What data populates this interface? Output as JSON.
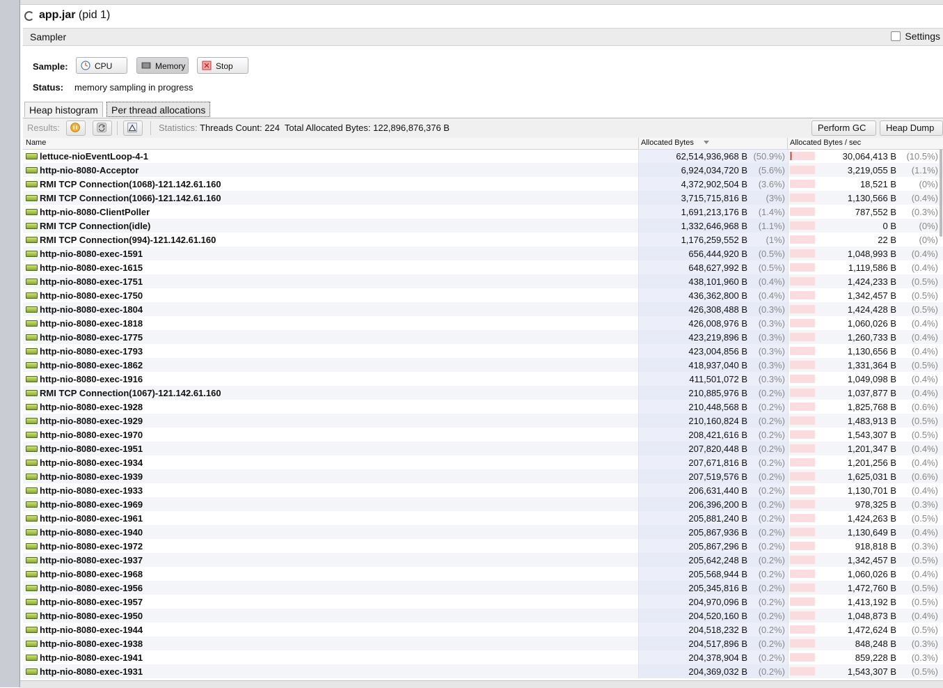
{
  "app": {
    "name": "app.jar",
    "pid": "(pid 1)"
  },
  "sampler": {
    "title": "Sampler",
    "settings_label": "Settings",
    "sample_label": "Sample:",
    "buttons": {
      "cpu": "CPU",
      "memory": "Memory",
      "stop": "Stop"
    },
    "status_label": "Status:",
    "status_value": "memory sampling in progress"
  },
  "tabs": [
    "Heap histogram",
    "Per thread allocations"
  ],
  "toolbar": {
    "results_label": "Results:",
    "statistics_label": "Statistics:",
    "threads_count": "Threads Count: 224",
    "total_allocated": "Total Allocated Bytes: 122,896,876,376 B",
    "perform_gc": "Perform GC",
    "heap_dump": "Heap Dump"
  },
  "columns": {
    "name": "Name",
    "allocated": "Allocated Bytes",
    "rate": "Allocated Bytes / sec"
  },
  "rows": [
    {
      "name": "lettuce-nioEventLoop-4-1",
      "bytes": "62,514,936,968 B",
      "pct": "(50.9%)",
      "rate": "30,064,413 B",
      "rate_pct": "(10.5%)",
      "rate_fraction": 0.105
    },
    {
      "name": "http-nio-8080-Acceptor",
      "bytes": "6,924,034,720 B",
      "pct": "(5.6%)",
      "rate": "3,219,055 B",
      "rate_pct": "(1.1%)",
      "rate_fraction": 0.011
    },
    {
      "name": "RMI TCP Connection(1068)-121.142.61.160",
      "bytes": "4,372,902,504 B",
      "pct": "(3.6%)",
      "rate": "18,521 B",
      "rate_pct": "(0%)",
      "rate_fraction": 0
    },
    {
      "name": "RMI TCP Connection(1066)-121.142.61.160",
      "bytes": "3,715,715,816 B",
      "pct": "(3%)",
      "rate": "1,130,566 B",
      "rate_pct": "(0.4%)",
      "rate_fraction": 0.004
    },
    {
      "name": "http-nio-8080-ClientPoller",
      "bytes": "1,691,213,176 B",
      "pct": "(1.4%)",
      "rate": "787,552 B",
      "rate_pct": "(0.3%)",
      "rate_fraction": 0.003
    },
    {
      "name": "RMI TCP Connection(idle)",
      "bytes": "1,332,646,968 B",
      "pct": "(1.1%)",
      "rate": "0 B",
      "rate_pct": "(0%)",
      "rate_fraction": 0
    },
    {
      "name": "RMI TCP Connection(994)-121.142.61.160",
      "bytes": "1,176,259,552 B",
      "pct": "(1%)",
      "rate": "22 B",
      "rate_pct": "(0%)",
      "rate_fraction": 0
    },
    {
      "name": "http-nio-8080-exec-1591",
      "bytes": "656,444,920 B",
      "pct": "(0.5%)",
      "rate": "1,048,993 B",
      "rate_pct": "(0.4%)",
      "rate_fraction": 0.004
    },
    {
      "name": "http-nio-8080-exec-1615",
      "bytes": "648,627,992 B",
      "pct": "(0.5%)",
      "rate": "1,119,586 B",
      "rate_pct": "(0.4%)",
      "rate_fraction": 0.004
    },
    {
      "name": "http-nio-8080-exec-1751",
      "bytes": "438,101,960 B",
      "pct": "(0.4%)",
      "rate": "1,424,233 B",
      "rate_pct": "(0.5%)",
      "rate_fraction": 0.005
    },
    {
      "name": "http-nio-8080-exec-1750",
      "bytes": "436,362,800 B",
      "pct": "(0.4%)",
      "rate": "1,342,457 B",
      "rate_pct": "(0.5%)",
      "rate_fraction": 0.005
    },
    {
      "name": "http-nio-8080-exec-1804",
      "bytes": "426,308,488 B",
      "pct": "(0.3%)",
      "rate": "1,424,428 B",
      "rate_pct": "(0.5%)",
      "rate_fraction": 0.005
    },
    {
      "name": "http-nio-8080-exec-1818",
      "bytes": "426,008,976 B",
      "pct": "(0.3%)",
      "rate": "1,060,026 B",
      "rate_pct": "(0.4%)",
      "rate_fraction": 0.004
    },
    {
      "name": "http-nio-8080-exec-1775",
      "bytes": "423,219,896 B",
      "pct": "(0.3%)",
      "rate": "1,260,733 B",
      "rate_pct": "(0.4%)",
      "rate_fraction": 0.004
    },
    {
      "name": "http-nio-8080-exec-1793",
      "bytes": "423,004,856 B",
      "pct": "(0.3%)",
      "rate": "1,130,656 B",
      "rate_pct": "(0.4%)",
      "rate_fraction": 0.004
    },
    {
      "name": "http-nio-8080-exec-1862",
      "bytes": "418,937,040 B",
      "pct": "(0.3%)",
      "rate": "1,331,364 B",
      "rate_pct": "(0.5%)",
      "rate_fraction": 0.005
    },
    {
      "name": "http-nio-8080-exec-1916",
      "bytes": "411,501,072 B",
      "pct": "(0.3%)",
      "rate": "1,049,098 B",
      "rate_pct": "(0.4%)",
      "rate_fraction": 0.004
    },
    {
      "name": "RMI TCP Connection(1067)-121.142.61.160",
      "bytes": "210,885,976 B",
      "pct": "(0.2%)",
      "rate": "1,037,877 B",
      "rate_pct": "(0.4%)",
      "rate_fraction": 0.004
    },
    {
      "name": "http-nio-8080-exec-1928",
      "bytes": "210,448,568 B",
      "pct": "(0.2%)",
      "rate": "1,825,768 B",
      "rate_pct": "(0.6%)",
      "rate_fraction": 0.006
    },
    {
      "name": "http-nio-8080-exec-1929",
      "bytes": "210,160,824 B",
      "pct": "(0.2%)",
      "rate": "1,483,913 B",
      "rate_pct": "(0.5%)",
      "rate_fraction": 0.005
    },
    {
      "name": "http-nio-8080-exec-1970",
      "bytes": "208,421,616 B",
      "pct": "(0.2%)",
      "rate": "1,543,307 B",
      "rate_pct": "(0.5%)",
      "rate_fraction": 0.005
    },
    {
      "name": "http-nio-8080-exec-1951",
      "bytes": "207,820,448 B",
      "pct": "(0.2%)",
      "rate": "1,201,347 B",
      "rate_pct": "(0.4%)",
      "rate_fraction": 0.004
    },
    {
      "name": "http-nio-8080-exec-1934",
      "bytes": "207,671,816 B",
      "pct": "(0.2%)",
      "rate": "1,201,256 B",
      "rate_pct": "(0.4%)",
      "rate_fraction": 0.004
    },
    {
      "name": "http-nio-8080-exec-1939",
      "bytes": "207,519,576 B",
      "pct": "(0.2%)",
      "rate": "1,625,031 B",
      "rate_pct": "(0.6%)",
      "rate_fraction": 0.006
    },
    {
      "name": "http-nio-8080-exec-1933",
      "bytes": "206,631,440 B",
      "pct": "(0.2%)",
      "rate": "1,130,701 B",
      "rate_pct": "(0.4%)",
      "rate_fraction": 0.004
    },
    {
      "name": "http-nio-8080-exec-1969",
      "bytes": "206,396,200 B",
      "pct": "(0.2%)",
      "rate": "978,325 B",
      "rate_pct": "(0.3%)",
      "rate_fraction": 0.003
    },
    {
      "name": "http-nio-8080-exec-1961",
      "bytes": "205,881,240 B",
      "pct": "(0.2%)",
      "rate": "1,424,263 B",
      "rate_pct": "(0.5%)",
      "rate_fraction": 0.005
    },
    {
      "name": "http-nio-8080-exec-1940",
      "bytes": "205,867,936 B",
      "pct": "(0.2%)",
      "rate": "1,130,649 B",
      "rate_pct": "(0.4%)",
      "rate_fraction": 0.004
    },
    {
      "name": "http-nio-8080-exec-1972",
      "bytes": "205,867,296 B",
      "pct": "(0.2%)",
      "rate": "918,818 B",
      "rate_pct": "(0.3%)",
      "rate_fraction": 0.003
    },
    {
      "name": "http-nio-8080-exec-1937",
      "bytes": "205,642,248 B",
      "pct": "(0.2%)",
      "rate": "1,342,457 B",
      "rate_pct": "(0.5%)",
      "rate_fraction": 0.005
    },
    {
      "name": "http-nio-8080-exec-1968",
      "bytes": "205,568,944 B",
      "pct": "(0.2%)",
      "rate": "1,060,026 B",
      "rate_pct": "(0.4%)",
      "rate_fraction": 0.004
    },
    {
      "name": "http-nio-8080-exec-1956",
      "bytes": "205,345,816 B",
      "pct": "(0.2%)",
      "rate": "1,472,760 B",
      "rate_pct": "(0.5%)",
      "rate_fraction": 0.005
    },
    {
      "name": "http-nio-8080-exec-1957",
      "bytes": "204,970,096 B",
      "pct": "(0.2%)",
      "rate": "1,413,192 B",
      "rate_pct": "(0.5%)",
      "rate_fraction": 0.005
    },
    {
      "name": "http-nio-8080-exec-1950",
      "bytes": "204,520,160 B",
      "pct": "(0.2%)",
      "rate": "1,048,873 B",
      "rate_pct": "(0.4%)",
      "rate_fraction": 0.004
    },
    {
      "name": "http-nio-8080-exec-1944",
      "bytes": "204,518,232 B",
      "pct": "(0.2%)",
      "rate": "1,472,624 B",
      "rate_pct": "(0.5%)",
      "rate_fraction": 0.005
    },
    {
      "name": "http-nio-8080-exec-1938",
      "bytes": "204,517,896 B",
      "pct": "(0.2%)",
      "rate": "848,248 B",
      "rate_pct": "(0.3%)",
      "rate_fraction": 0.003
    },
    {
      "name": "http-nio-8080-exec-1941",
      "bytes": "204,378,904 B",
      "pct": "(0.2%)",
      "rate": "859,228 B",
      "rate_pct": "(0.3%)",
      "rate_fraction": 0.003
    },
    {
      "name": "http-nio-8080-exec-1931",
      "bytes": "204,369,032 B",
      "pct": "(0.2%)",
      "rate": "1,543,307 B",
      "rate_pct": "(0.5%)",
      "rate_fraction": 0.005
    }
  ]
}
